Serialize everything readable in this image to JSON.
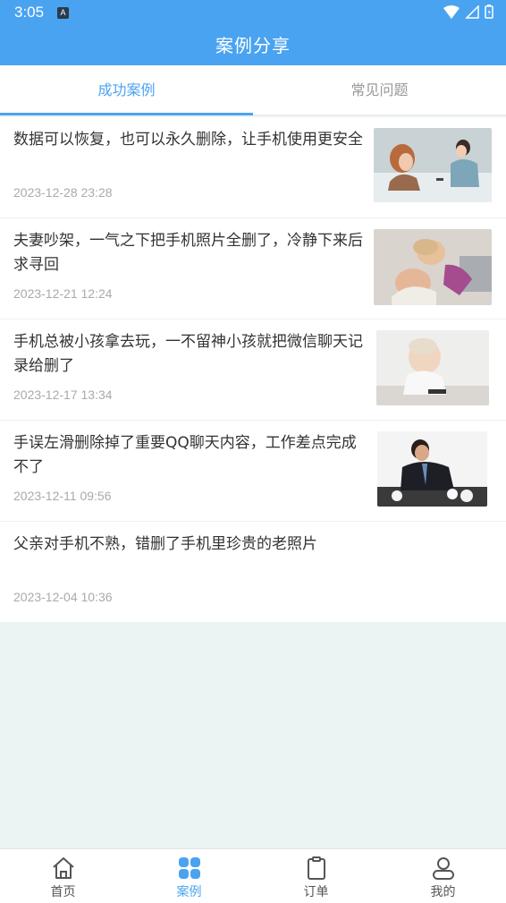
{
  "status_bar": {
    "time": "3:05",
    "notification": "A"
  },
  "header": {
    "title": "案例分享"
  },
  "tabs": [
    {
      "label": "成功案例",
      "active": true
    },
    {
      "label": "常见问题",
      "active": false
    }
  ],
  "cases": [
    {
      "title": "数据可以恢复，也可以永久删除，让手机使用更安全",
      "date": "2023-12-28 23:28",
      "image": "couple-at-table-photo"
    },
    {
      "title": "夫妻吵架，一气之下把手机照片全删了，冷静下来后求寻回",
      "date": "2023-12-21 12:24",
      "image": "family-lying-photo"
    },
    {
      "title": "手机总被小孩拿去玩，一不留神小孩就把微信聊天记录给删了",
      "date": "2023-12-17 13:34",
      "image": "baby-with-phone-photo"
    },
    {
      "title": "手误左滑删除掉了重要QQ聊天内容，工作差点完成不了",
      "date": "2023-12-11 09:56",
      "image": "stressed-businessman-photo"
    },
    {
      "title": "父亲对手机不熟，错删了手机里珍贵的老照片",
      "date": "2023-12-04 10:36",
      "image": null
    }
  ],
  "bottom_nav": [
    {
      "label": "首页",
      "icon": "home-icon",
      "active": false
    },
    {
      "label": "案例",
      "icon": "grid-icon",
      "active": true
    },
    {
      "label": "订单",
      "icon": "clipboard-icon",
      "active": false
    },
    {
      "label": "我的",
      "icon": "person-icon",
      "active": false
    }
  ],
  "colors": {
    "accent": "#4aa3f0",
    "background": "#ebf4f2"
  }
}
